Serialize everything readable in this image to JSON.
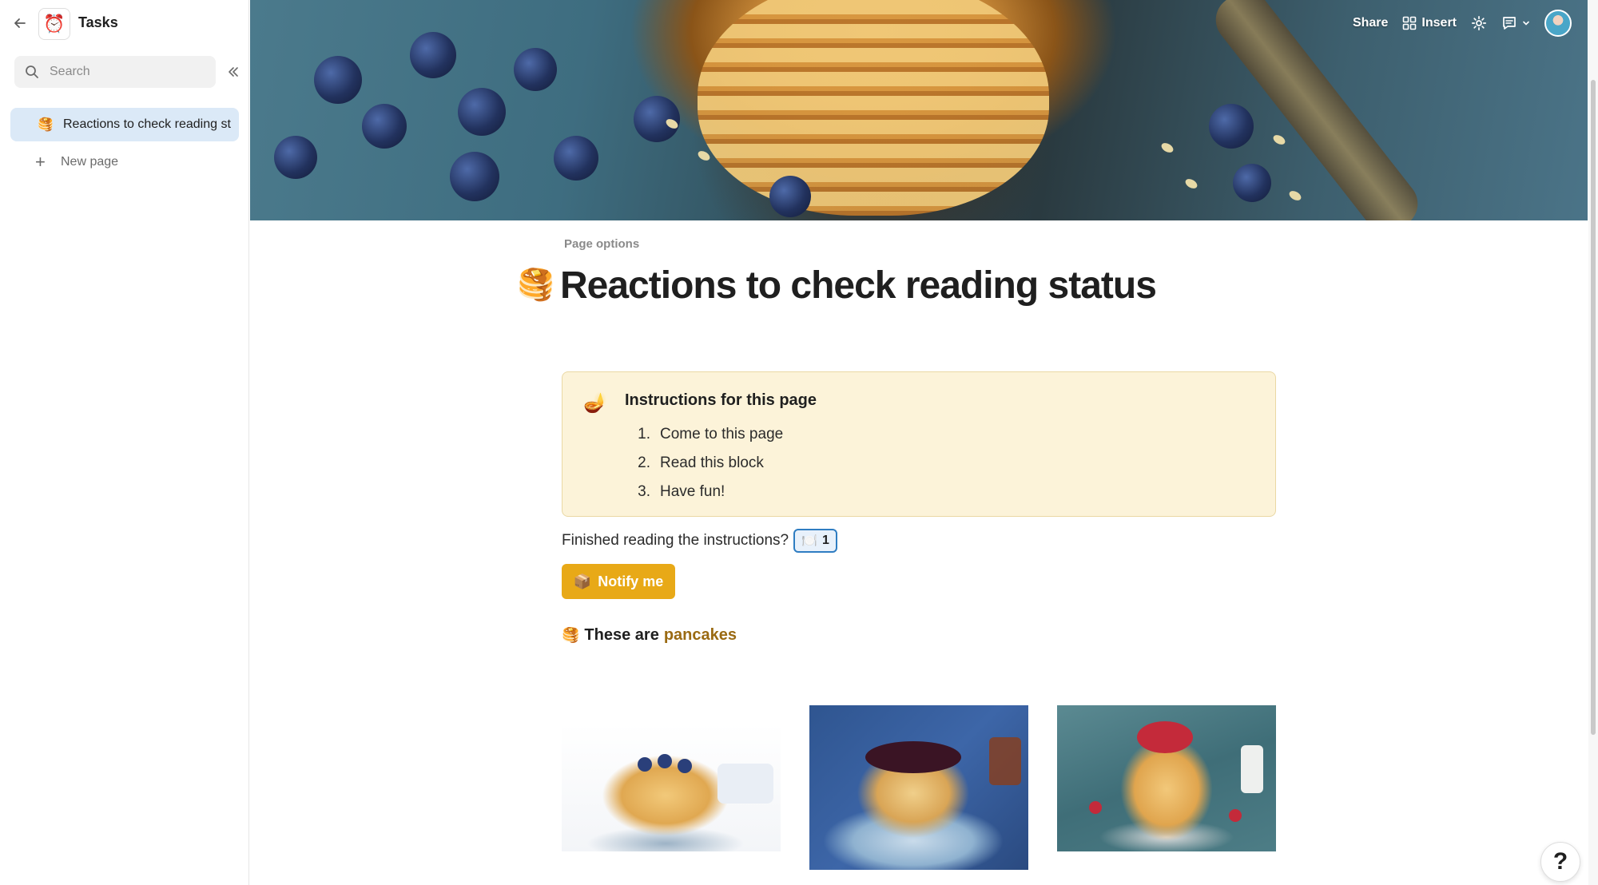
{
  "sidebar": {
    "doc_title": "Tasks",
    "doc_icon": "⏰",
    "search": {
      "placeholder": "Search",
      "value": ""
    },
    "pages": [
      {
        "emoji": "🥞",
        "label": "Reactions to check reading status",
        "selected": true
      }
    ],
    "new_page_label": "New page"
  },
  "topbar": {
    "share_label": "Share",
    "insert_label": "Insert"
  },
  "page": {
    "options_label": "Page options",
    "emoji": "🥞",
    "title": "Reactions to check reading status",
    "callout": {
      "emoji": "🪔",
      "heading": "Instructions for this page",
      "items": [
        {
          "num": "1.",
          "text": "Come to this page"
        },
        {
          "num": "2.",
          "text": "Read this block"
        },
        {
          "num": "3.",
          "text": "Have fun!"
        }
      ],
      "background": "#fcf3d9"
    },
    "finished_text": "Finished reading the instructions?",
    "reaction": {
      "emoji": "🍽️",
      "count": "1"
    },
    "notify_button": {
      "icon": "📦",
      "label": "Notify me",
      "color": "#e8a917"
    },
    "pancake_heading": {
      "emoji": "🥞",
      "prefix": "These are",
      "link": "pancakes"
    }
  },
  "help_label": "?",
  "colors": {
    "accent": "#2f7dc2",
    "selected_nav": "#dbe9f7",
    "link": "#9a6a12"
  }
}
